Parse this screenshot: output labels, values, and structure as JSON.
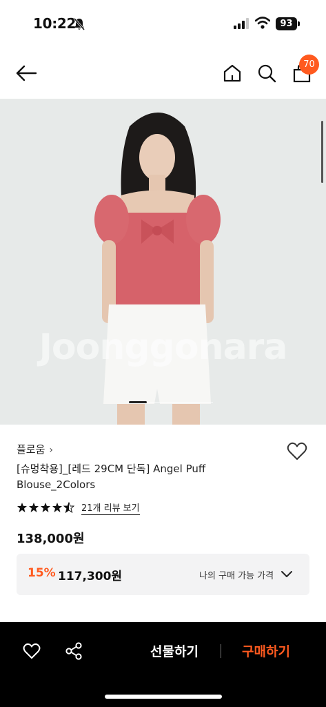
{
  "status_bar": {
    "time": "10:22",
    "battery": "93"
  },
  "nav": {
    "cart_count": "70",
    "icons": [
      "arrow-left-icon",
      "home-icon",
      "search-icon",
      "shopping-bag-icon"
    ]
  },
  "product": {
    "image_watermark": "Joonggonara",
    "brand": "플로움",
    "title": "[슈멍착용]_[레드 29CM 단독] Angel Puff Blouse_2Colors",
    "rating": 4.5,
    "review_link": "21개 리뷰 보기",
    "price": "138,000원",
    "discount_rate": "15%",
    "discounted_price": "117,300원",
    "my_price_label": "나의 구매 가능 가격"
  },
  "bottom_bar": {
    "gift_label": "선물하기",
    "buy_label": "구매하기"
  },
  "colors": {
    "accent": "#ff5a1f",
    "bottom_bar_bg": "#000000",
    "discount_box_bg": "#f3f3f4"
  }
}
